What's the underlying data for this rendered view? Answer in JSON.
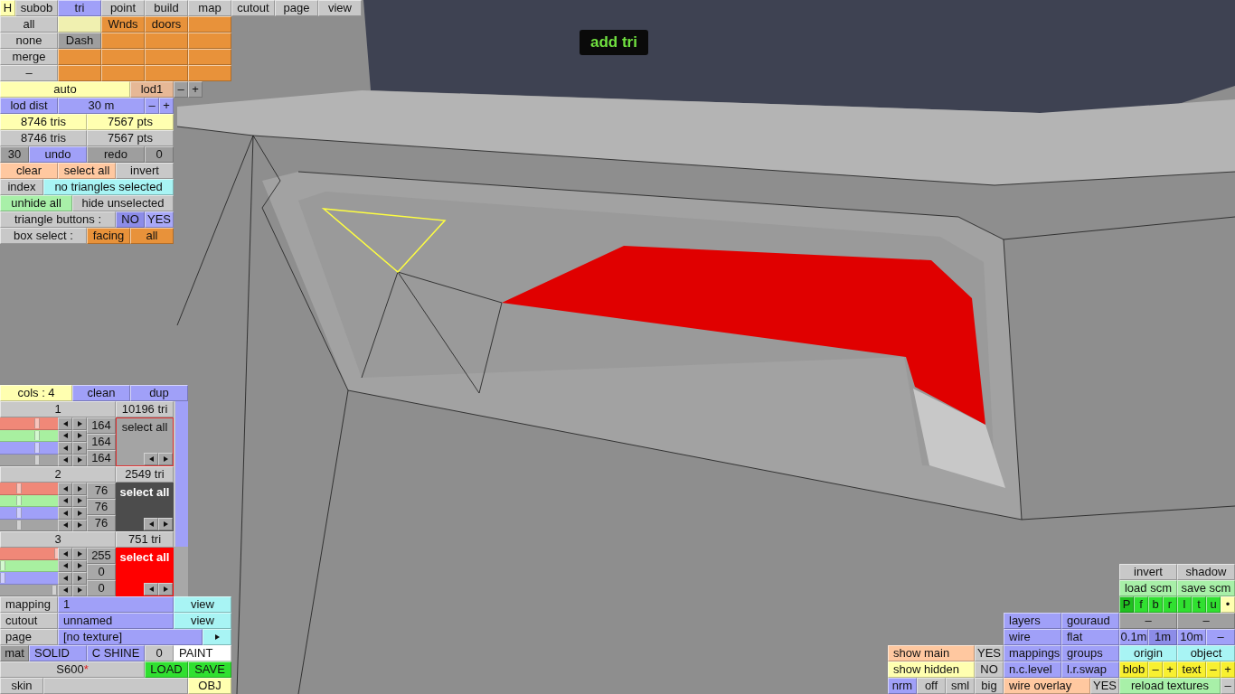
{
  "h_button": {
    "label": "H",
    "color": "#ffffb0"
  },
  "tabs": [
    {
      "label": "subob",
      "selected": false
    },
    {
      "label": "tri",
      "selected": true
    },
    {
      "label": "point",
      "selected": false
    },
    {
      "label": "build",
      "selected": false
    },
    {
      "label": "map",
      "selected": false
    },
    {
      "label": "cutout",
      "selected": false
    },
    {
      "label": "page",
      "selected": false
    },
    {
      "label": "view",
      "selected": false
    }
  ],
  "tool_rows": [
    [
      {
        "label": "all",
        "color": "#c8c8c8"
      },
      {
        "color": "#f0f0b0"
      },
      {
        "label": "Wnds",
        "color": "#e8923a"
      },
      {
        "label": "doors",
        "color": "#e8923a"
      },
      {
        "color": "#e8923a"
      }
    ],
    [
      {
        "label": "none",
        "color": "#c8c8c8"
      },
      {
        "label": "Dash",
        "color": "#9e9e9e"
      },
      {
        "color": "#e8923a"
      },
      {
        "color": "#e8923a"
      },
      {
        "color": "#e8923a"
      }
    ],
    [
      {
        "label": "merge",
        "color": "#c8c8c8"
      },
      {
        "color": "#e8923a"
      },
      {
        "color": "#e8923a"
      },
      {
        "color": "#e8923a"
      },
      {
        "color": "#e8923a"
      }
    ],
    [
      {
        "label": "–",
        "color": "#c8c8c8"
      },
      {
        "color": "#e8923a"
      },
      {
        "color": "#e8923a"
      },
      {
        "color": "#e8923a"
      },
      {
        "color": "#e8923a"
      }
    ],
    [
      {
        "label": "auto",
        "color": "#ffffb0"
      },
      {
        "label": "lod1",
        "color": "#e6b896"
      },
      {
        "label": "–",
        "color": "#9e9e9e"
      },
      {
        "label": "+",
        "color": "#9e9e9e"
      }
    ],
    [
      {
        "label": "lod dist",
        "color": "#a0a0f8"
      },
      {
        "label": "30 m",
        "color": "#a0a0f8"
      },
      {
        "label": "–",
        "color": "#a0a0f8"
      },
      {
        "label": "+",
        "color": "#a0a0f8"
      }
    ],
    [
      {
        "label": "8746 tris",
        "color": "#ffffb0"
      },
      {
        "label": "7567 pts",
        "color": "#ffffb0"
      }
    ],
    [
      {
        "label": "8746 tris",
        "color": "#c8c8c8"
      },
      {
        "label": "7567 pts",
        "color": "#c8c8c8"
      }
    ],
    [
      {
        "label": "30",
        "color": "#9e9e9e"
      },
      {
        "label": "undo",
        "color": "#a0a0f8"
      },
      {
        "label": "redo",
        "color": "#9e9e9e"
      },
      {
        "label": "0",
        "color": "#9e9e9e"
      }
    ],
    [
      {
        "label": "clear",
        "color": "#ffc8a0"
      },
      {
        "label": "select all",
        "color": "#ffc8a0"
      },
      {
        "label": "invert",
        "color": "#c8c8c8"
      }
    ],
    [
      {
        "label": "index",
        "color": "#c8c8c8"
      },
      {
        "label": "no triangles selected",
        "color": "#a8f4f4"
      }
    ],
    [
      {
        "label": "unhide all",
        "color": "#a8f0a8"
      },
      {
        "label": "hide unselected",
        "color": "#c8c8c8"
      }
    ],
    [
      {
        "label": "triangle buttons :",
        "color": "#c8c8c8"
      },
      {
        "label": "NO",
        "color": "#8c8ce8"
      },
      {
        "label": "YES",
        "color": "#a8a8f8"
      }
    ],
    [
      {
        "label": "box select :",
        "color": "#c8c8c8"
      },
      {
        "label": "facing",
        "color": "#e8923a"
      },
      {
        "label": "all",
        "color": "#e8923a"
      }
    ]
  ],
  "colors_panel": {
    "header": [
      {
        "label": "cols : 4",
        "color": "#ffffb0"
      },
      {
        "label": "clean",
        "color": "#a0a0f8"
      },
      {
        "label": "dup",
        "color": "#a0a0f8"
      }
    ],
    "groups": [
      {
        "number": "1",
        "tri_count": "10196 tri",
        "sliders": [
          {
            "level": 0.64
          },
          {
            "level": 0.64
          },
          {
            "level": 0.64
          },
          {
            "level": 0.64
          }
        ],
        "values": [
          "164",
          "164",
          "164"
        ],
        "swatch": {
          "label": "select all",
          "color": "#a4a4a4",
          "selected": true
        }
      },
      {
        "number": "2",
        "tri_count": "2549 tri",
        "sliders": [
          {
            "level": 0.3
          },
          {
            "level": 0.3
          },
          {
            "level": 0.3
          },
          {
            "level": 0.3
          }
        ],
        "values": [
          "76",
          "76",
          "76"
        ],
        "swatch": {
          "label": "select all",
          "color": "#4c4c4c",
          "selected": false
        }
      },
      {
        "number": "3",
        "tri_count": "751 tri",
        "sliders": [
          {
            "level": 1
          },
          {
            "level": 0
          },
          {
            "level": 0
          },
          {
            "level": 0.95
          }
        ],
        "values": [
          "255",
          "0",
          "0"
        ],
        "swatch": {
          "label": "select all",
          "color": "#ff0000",
          "selected": false
        }
      }
    ]
  },
  "material_rows": [
    [
      {
        "label": "mapping",
        "color": "#c8c8c8"
      },
      {
        "label": "1",
        "color": "#a0a0f8"
      },
      {
        "label": "view",
        "color": "#a8f4f4"
      }
    ],
    [
      {
        "label": "cutout",
        "color": "#c8c8c8"
      },
      {
        "label": "unnamed",
        "color": "#a0a0f8"
      },
      {
        "label": "view",
        "color": "#a8f4f4"
      }
    ],
    [
      {
        "label": "page",
        "color": "#c8c8c8"
      },
      {
        "label": "[no texture]",
        "color": "#a0a0f8"
      },
      {
        "kind": "arrow",
        "color": "#a8f4f4"
      }
    ],
    [
      {
        "label": "mat",
        "color": "#9e9e9e"
      },
      {
        "label": "SOLID",
        "color": "#a0a0f8"
      },
      {
        "label": "C SHINE",
        "color": "#a0a0f8"
      },
      {
        "label": "0",
        "color": "#c8c8c8"
      },
      {
        "label": "PAINT",
        "color": "#ffffff"
      }
    ],
    [
      {
        "label": "S600",
        "suffix": "*",
        "color": "#c8c8c8"
      },
      {
        "label": "LOAD",
        "color": "#30e030"
      },
      {
        "label": "SAVE",
        "color": "#30e030"
      }
    ],
    [
      {
        "label": "skin",
        "color": "#c8c8c8"
      },
      {
        "color": "#c8c8c8"
      },
      {
        "label": "OBJ",
        "color": "#ffffb0"
      }
    ]
  ],
  "view_panels": {
    "left": [
      [
        {
          "label": "show main",
          "color": "#ffc8a0"
        },
        {
          "label": "YES",
          "color": "#c8c8c8"
        }
      ],
      [
        {
          "label": "show hidden",
          "color": "#ffffb0"
        },
        {
          "label": "NO",
          "color": "#c8c8c8"
        }
      ],
      [
        {
          "label": "nrm",
          "color": "#a0a0f8"
        },
        {
          "label": "off",
          "color": "#c8c8c8"
        },
        {
          "label": "sml",
          "color": "#c8c8c8"
        },
        {
          "label": "big",
          "color": "#c8c8c8"
        }
      ]
    ],
    "middle": [
      [
        {
          "label": "layers",
          "color": "#a0a0f8"
        },
        {
          "label": "gouraud",
          "color": "#a0a0f8"
        }
      ],
      [
        {
          "label": "wire",
          "color": "#a0a0f8"
        },
        {
          "label": "flat",
          "color": "#a0a0f8"
        }
      ],
      [
        {
          "label": "mappings",
          "color": "#a0a0f8"
        },
        {
          "label": "groups",
          "color": "#a0a0f8"
        }
      ],
      [
        {
          "label": "n.c.level",
          "color": "#a0a0f8"
        },
        {
          "label": "l.r.swap",
          "color": "#a0a0f8"
        }
      ],
      [
        {
          "label": "wire overlay",
          "color": "#ffc8a0"
        },
        {
          "label": "YES",
          "color": "#c8c8c8"
        }
      ]
    ],
    "right": [
      [
        {
          "label": "invert",
          "color": "#c8c8c8"
        },
        {
          "label": "shadow",
          "color": "#c8c8c8"
        }
      ],
      [
        {
          "label": "load scm",
          "color": "#a8f0a8"
        },
        {
          "label": "save scm",
          "color": "#a8f0a8"
        }
      ],
      [
        {
          "label": "P",
          "color": "#20c020"
        },
        {
          "label": "f",
          "color": "#30e030"
        },
        {
          "label": "b",
          "color": "#30e030"
        },
        {
          "label": "r",
          "color": "#30e030"
        },
        {
          "label": "l",
          "color": "#30e030"
        },
        {
          "label": "t",
          "color": "#30e030"
        },
        {
          "label": "u",
          "color": "#30e030"
        },
        {
          "label": "•",
          "color": "#ffffb0"
        }
      ],
      [
        {
          "label": "–",
          "color": "#a0a0a0"
        },
        {
          "label": "–",
          "color": "#a0a0a0"
        }
      ],
      [
        {
          "label": "0.1m",
          "color": "#a0a0f8"
        },
        {
          "label": "1m",
          "color": "#8c8ce8"
        },
        {
          "label": "10m",
          "color": "#a0a0f8"
        },
        {
          "label": "–",
          "color": "#a0a0f8"
        }
      ],
      [
        {
          "label": "origin",
          "color": "#a8f4f4"
        },
        {
          "label": "object",
          "color": "#a8f4f4"
        }
      ],
      [
        {
          "label": "blob",
          "color": "#f8f030"
        },
        {
          "label": "–",
          "color": "#f8f030"
        },
        {
          "label": "+",
          "color": "#f8f030"
        },
        {
          "label": "text",
          "color": "#f8f030"
        },
        {
          "label": "–",
          "color": "#f8f030"
        },
        {
          "label": "+",
          "color": "#f8f030"
        }
      ],
      [
        {
          "label": "reload textures",
          "color": "#a8f0a8"
        },
        {
          "label": "–",
          "color": "#c8c8c8"
        }
      ]
    ]
  },
  "status_message": "add tri"
}
